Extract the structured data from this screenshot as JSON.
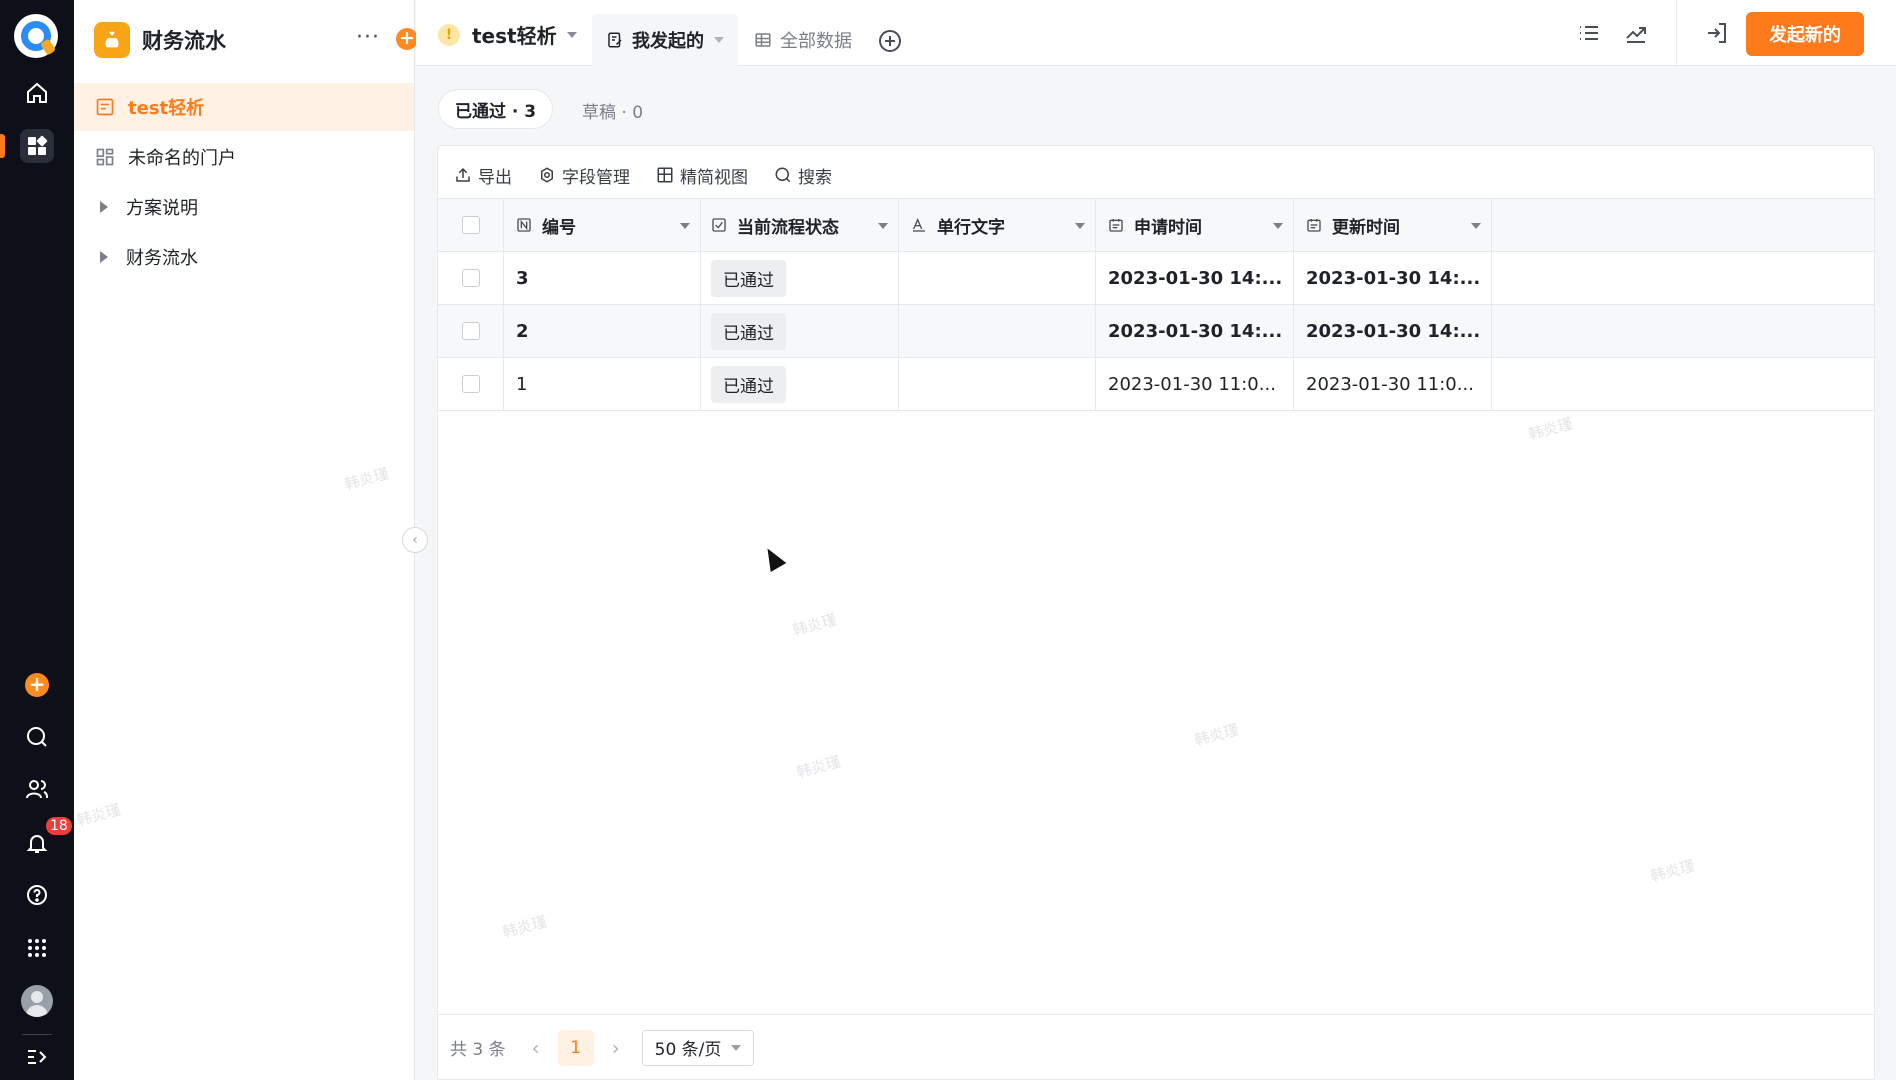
{
  "rail": {
    "items": [
      "home-icon",
      "apps-icon",
      "search-icon",
      "contacts-icon",
      "bell-icon",
      "help-icon",
      "grid-icon",
      "expand-icon"
    ],
    "notification_count": "18",
    "add_symbol": "+"
  },
  "sidebar": {
    "app_title": "财务流水",
    "more_symbol": "···",
    "add_symbol": "+",
    "items": [
      {
        "label": "test轻析",
        "icon": "form-icon",
        "active": true
      },
      {
        "label": "未命名的门户",
        "icon": "portal-icon"
      },
      {
        "label": "方案说明",
        "icon": "caret-right-icon"
      },
      {
        "label": "财务流水",
        "icon": "caret-right-icon"
      }
    ],
    "collapse_symbol": "‹"
  },
  "topbar": {
    "form_title": "test轻析",
    "warn_symbol": "!",
    "view_tab": "我发起的",
    "all_data_tab": "全部数据",
    "start_button": "发起新的"
  },
  "filters": {
    "approved": "已通过 · 3",
    "draft": "草稿 · 0"
  },
  "toolbar": {
    "export": "导出",
    "fields": "字段管理",
    "compact": "精简视图",
    "search": "搜索"
  },
  "table": {
    "columns": [
      "编号",
      "当前流程状态",
      "单行文字",
      "申请时间",
      "更新时间"
    ],
    "rows": [
      {
        "id": "3",
        "status": "已通过",
        "text": "",
        "applied": "2023-01-30 14:...",
        "updated": "2023-01-30 14:..."
      },
      {
        "id": "2",
        "status": "已通过",
        "text": "",
        "applied": "2023-01-30 14:...",
        "updated": "2023-01-30 14:..."
      },
      {
        "id": "1",
        "status": "已通过",
        "text": "",
        "applied": "2023-01-30 11:0...",
        "updated": "2023-01-30 11:0..."
      }
    ]
  },
  "pager": {
    "total": "共 3 条",
    "prev": "‹",
    "next": "›",
    "page": "1",
    "page_size": "50 条/页"
  },
  "watermark": "韩炎瑾",
  "colors": {
    "accent": "#ff7a1a",
    "rail_bg": "#0d1018"
  }
}
